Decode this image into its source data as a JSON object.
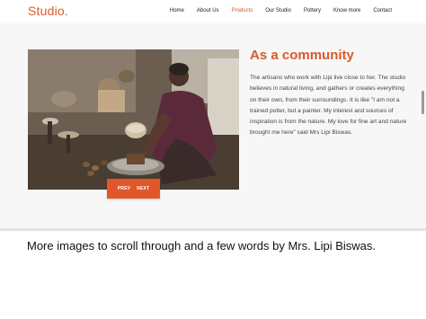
{
  "brand": {
    "logo": "Studio.",
    "accent_color": "#d85a2a"
  },
  "nav": {
    "items": [
      {
        "label": "Home"
      },
      {
        "label": "About Us"
      },
      {
        "label": "Products",
        "active": true
      },
      {
        "label": "Our Studio"
      },
      {
        "label": "Pottery"
      },
      {
        "label": "Know more"
      },
      {
        "label": "Contact"
      }
    ]
  },
  "hero": {
    "heading": "As a community",
    "body": "The artisans who work with Lipi live close to her. The studio believes in natural living, and gathers or creates everything on their own, from their surroundings. It is like \"I am not a trained potter, but a painter. My interest and sources of inspiration is from the nature. My love for fine art and nature brought me here\" said Mrs Lipi Biswas.",
    "prev_label": "PREV",
    "next_label": "NEXT",
    "button_color": "#e2572a"
  },
  "caption": {
    "text": "More images to scroll through and a few words by Mrs. Lipi Biswas."
  }
}
